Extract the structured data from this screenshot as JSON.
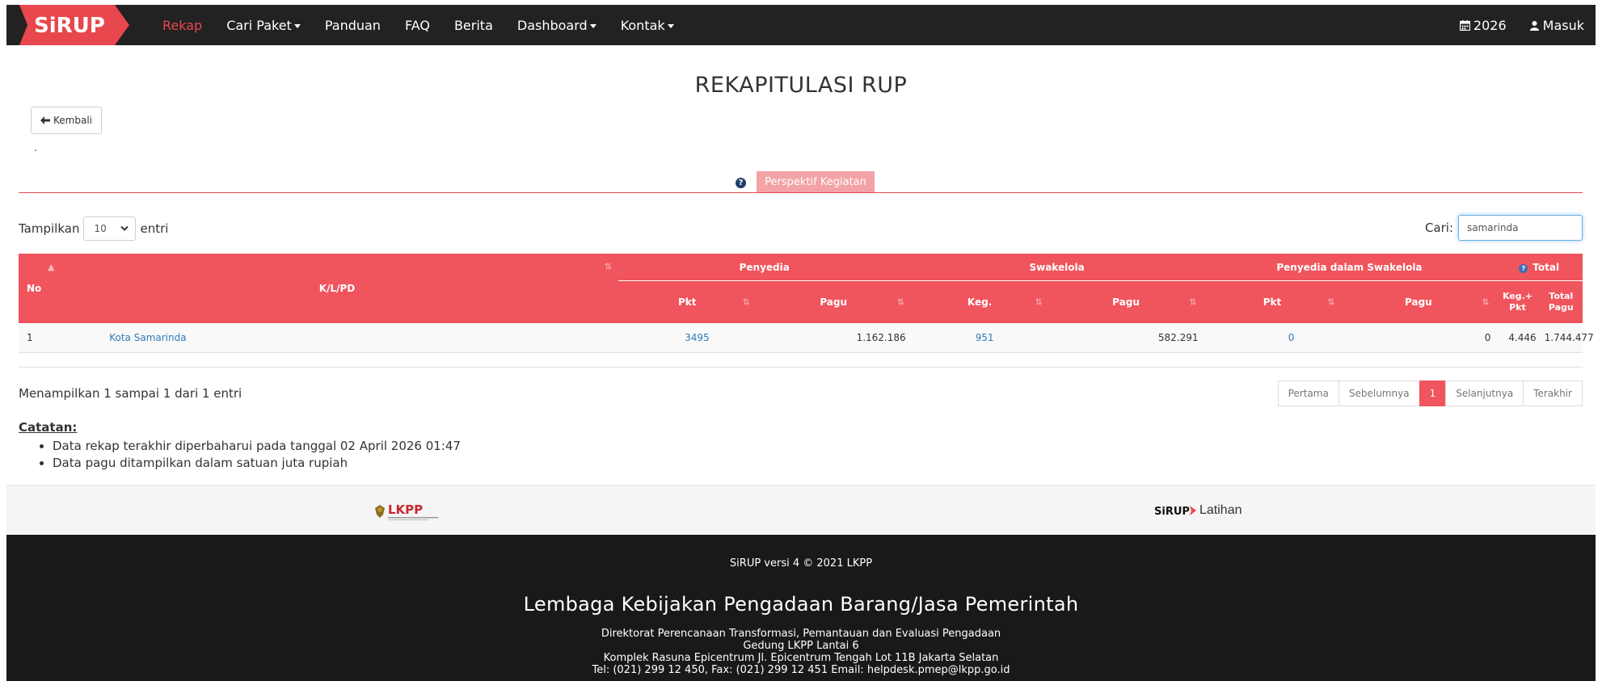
{
  "nav": {
    "logo_text": "SiRUP",
    "links": [
      {
        "label": "Rekap",
        "active": true,
        "dropdown": false
      },
      {
        "label": "Cari Paket",
        "active": false,
        "dropdown": true
      },
      {
        "label": "Panduan",
        "active": false,
        "dropdown": false
      },
      {
        "label": "FAQ",
        "active": false,
        "dropdown": false
      },
      {
        "label": "Berita",
        "active": false,
        "dropdown": false
      },
      {
        "label": "Dashboard",
        "active": false,
        "dropdown": true
      },
      {
        "label": "Kontak",
        "active": false,
        "dropdown": true
      }
    ],
    "year": "2026",
    "login": "Masuk"
  },
  "page": {
    "title": "REKAPITULASI RUP",
    "back_label": "Kembali",
    "dot": "."
  },
  "tab": {
    "help": "?",
    "label": "Perspektif Kegiatan"
  },
  "controls": {
    "show_prefix": "Tampilkan",
    "show_value": "10",
    "show_suffix": "entri",
    "search_label": "Cari:",
    "search_value": "samarinda"
  },
  "table": {
    "headers": {
      "no": "No",
      "klpd": "K/L/PD",
      "penyedia": "Penyedia",
      "swakelola": "Swakelola",
      "penyedia_swakelola": "Penyedia dalam Swakelola",
      "total": "Total",
      "pkt": "Pkt",
      "pagu": "Pagu",
      "keg": "Keg.",
      "pagu2": "Pagu",
      "pkt2": "Pkt",
      "pagu3": "Pagu",
      "keg_pkt": "Keg.+ Pkt",
      "total_pagu": "Total Pagu"
    },
    "rows": [
      {
        "no": "1",
        "klpd": "Kota Samarinda",
        "penyedia_pkt": "3495",
        "penyedia_pagu": "1.162.186",
        "swakelola_keg": "951",
        "swakelola_pagu": "582.291",
        "pds_pkt": "0",
        "pds_pagu": "0",
        "total_kegpkt": "4.446",
        "total_pagu": "1.744.477"
      }
    ]
  },
  "info": "Menampilkan 1 sampai 1 dari 1 entri",
  "pagination": [
    "Pertama",
    "Sebelumnya",
    "1",
    "Selanjutnya",
    "Terakhir"
  ],
  "notes": {
    "title": "Catatan:",
    "items": [
      "Data rekap terakhir diperbaharui pada tanggal 02 April 2026 01:47",
      "Data pagu ditampilkan dalam satuan juta rupiah"
    ]
  },
  "footer": {
    "lkpp_logo": "LKPP",
    "sirup_logo": "SiRUP",
    "latihan": "Latihan",
    "version": "SiRUP versi 4 © 2021 LKPP",
    "org": "Lembaga Kebijakan Pengadaan Barang/Jasa Pemerintah",
    "address": [
      "Direktorat Perencanaan Transformasi, Pemantauan dan Evaluasi Pengadaan",
      "Gedung LKPP Lantai 6",
      "Komplek Rasuna Epicentrum Jl. Epicentrum Tengah Lot 11B Jakarta Selatan",
      "Tel: (021) 299 12 450, Fax: (021) 299 12 451 Email: helpdesk.pmep@lkpp.go.id"
    ]
  },
  "colors": {
    "brand_red": "#e8474d",
    "table_header": "#f0545c",
    "navbar": "#222222",
    "footer": "#191919",
    "link": "#337ab7"
  }
}
